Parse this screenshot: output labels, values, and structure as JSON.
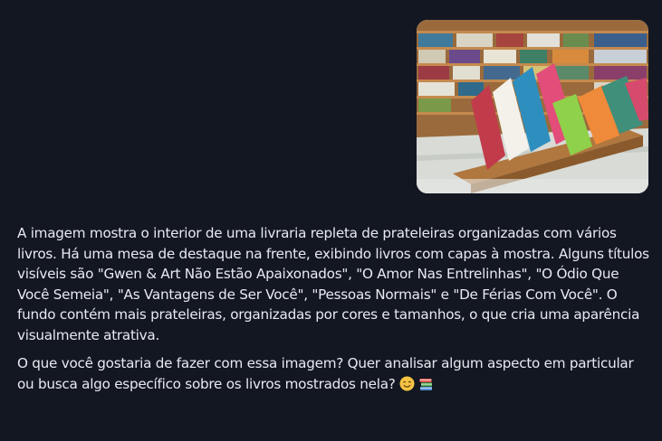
{
  "user_message": {
    "image_icon": "bookstore-photo"
  },
  "assistant_message": {
    "paragraph_1": "A imagem mostra o interior de uma livraria repleta de prateleiras organizadas com vários livros. Há uma mesa de destaque na frente, exibindo livros com capas à mostra. Alguns títulos visíveis são \"Gwen & Art Não Estão Apaixonados\", \"O Amor Nas Entrelinhas\", \"O Ódio Que Você Semeia\", \"As Vantagens de Ser Você\", \"Pessoas Normais\" e \"De Férias Com Você\". O fundo contém mais prateleiras, organizadas por cores e tamanhos, o que cria uma aparência visualmente atrativa.",
    "paragraph_2": "O que você gostaria de fazer com essa imagem? Quer analisar algum aspecto em particular ou busca algo específico sobre os livros mostrados nela?",
    "emoji_1": "smiling-face-icon",
    "emoji_2": "books-icon"
  },
  "colors": {
    "background": "#131722",
    "text": "#e8eaf0"
  }
}
